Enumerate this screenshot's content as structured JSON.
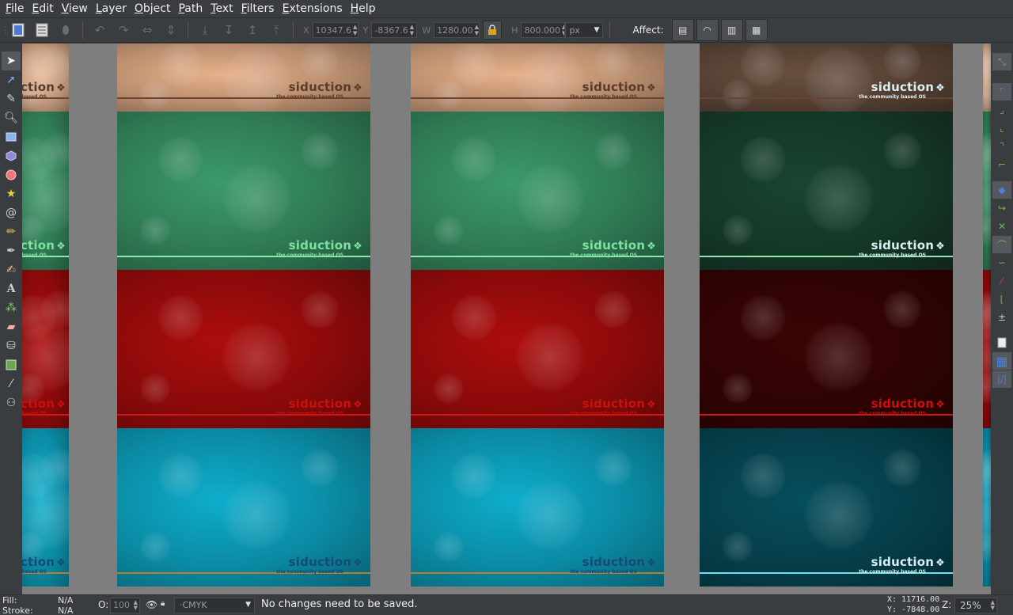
{
  "menu": [
    "File",
    "Edit",
    "View",
    "Layer",
    "Object",
    "Path",
    "Text",
    "Filters",
    "Extensions",
    "Help"
  ],
  "toolbar": {
    "x_label": "X",
    "x_value": "10347.6",
    "y_label": "Y",
    "y_value": "-8367.6",
    "w_label": "W",
    "w_value": "1280.00",
    "h_label": "H",
    "h_value": "800.000",
    "unit": "px",
    "affect_label": "Affect:"
  },
  "canvas": {
    "brand_name": "siduction",
    "tagline": "the community based OS",
    "row_colors": [
      "#b98d6e",
      "#2f7a55",
      "#8a0a0a",
      "#0b8aa3"
    ]
  },
  "status": {
    "fill_label": "Fill:",
    "fill_value": "N/A",
    "stroke_label": "Stroke:",
    "stroke_value": "N/A",
    "opacity_label": "O:",
    "opacity_value": "100",
    "layer_value": "·CMYK",
    "message": "No changes need to be saved.",
    "cursor_x": "X: 11716.00",
    "cursor_y": "Y: -7848.00",
    "zoom_label": "Z:",
    "zoom_value": "25%"
  }
}
